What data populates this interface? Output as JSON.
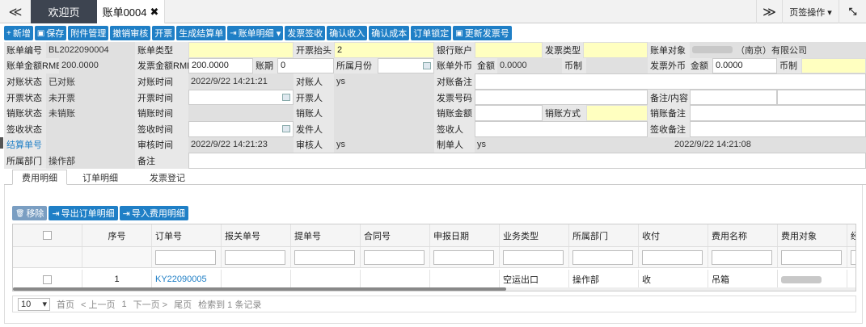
{
  "topbar": {
    "nav_left": "≪",
    "tab_welcome": "欢迎页",
    "tab_bill": "账单0004",
    "tab_close": "✖",
    "nav_right": "≫",
    "page_ops": "页签操作 ▾",
    "expand": "⤡"
  },
  "toolbar": [
    {
      "icon": "plus-icon",
      "glyph": "+",
      "label": "新增"
    },
    {
      "icon": "save-icon",
      "glyph": "▣",
      "label": "保存"
    },
    {
      "icon": "",
      "glyph": "",
      "label": "附件管理"
    },
    {
      "icon": "",
      "glyph": "",
      "label": "撤销审核"
    },
    {
      "icon": "",
      "glyph": "",
      "label": "开票"
    },
    {
      "icon": "",
      "glyph": "",
      "label": "生成结算单"
    },
    {
      "icon": "export-icon",
      "glyph": "⇥",
      "label": "账单明细 ▾"
    },
    {
      "icon": "",
      "glyph": "",
      "label": "发票签收"
    },
    {
      "icon": "",
      "glyph": "",
      "label": "确认收入"
    },
    {
      "icon": "",
      "glyph": "",
      "label": "确认成本"
    },
    {
      "icon": "",
      "glyph": "",
      "label": "订单锁定"
    },
    {
      "icon": "save-icon",
      "glyph": "▣",
      "label": "更新发票号"
    }
  ],
  "form": {
    "bill_no_label": "账单编号",
    "bill_no": "BL2022090004",
    "bill_type_label": "账单类型",
    "bill_type": "",
    "invoice_header_label": "开票抬头",
    "invoice_header": "2",
    "bank_account_label": "银行账户",
    "bank_account": "",
    "invoice_type_label": "发票类型",
    "invoice_type": "",
    "bill_target_label": "账单对象",
    "bill_target": "（南京）有限公司",
    "amount_rmb_label": "账单金额RMB",
    "amount_rmb": "200.0000",
    "invoice_amount_label": "发票金额RMB",
    "invoice_amount": "200.0000",
    "period_label": "账期",
    "period": "0",
    "month_label": "所属月份",
    "month": "",
    "foreign_label": "账单外币",
    "foreign_amount_label": "金额",
    "foreign_amount": "0.0000",
    "currency_label": "币制",
    "currency": "",
    "inv_foreign_label": "发票外币",
    "inv_foreign_amount_label": "金额",
    "inv_foreign_amount": "0.0000",
    "inv_currency_label": "币制",
    "inv_currency": "",
    "recon_status_label": "对账状态",
    "recon_status": "已对账",
    "recon_time_label": "对账时间",
    "recon_time": "2022/9/22 14:21:21",
    "recon_person_label": "对账人",
    "recon_person": "ys",
    "recon_note_label": "对账备注",
    "recon_note": "",
    "invoice_status_label": "开票状态",
    "invoice_status": "未开票",
    "invoice_time_label": "开票时间",
    "invoice_time": "",
    "invoicer_label": "开票人",
    "invoicer": "",
    "invoice_no_label": "发票号码",
    "invoice_no": "",
    "remark_content_label": "备注/内容",
    "remark_content": "",
    "writeoff_status_label": "销账状态",
    "writeoff_status": "未销账",
    "writeoff_time_label": "销账时间",
    "writeoff_time": "",
    "writeoff_person_label": "销账人",
    "writeoff_person": "",
    "writeoff_amount_label": "销账金额",
    "writeoff_amount": "",
    "writeoff_method_label": "销账方式",
    "writeoff_method": "",
    "writeoff_note_label": "销账备注",
    "writeoff_note": "",
    "sign_status_label": "签收状态",
    "sign_status": "",
    "sign_time_label": "签收时间",
    "sign_time": "",
    "sender_label": "发件人",
    "sender": "",
    "receiver_label": "签收人",
    "receiver": "",
    "sign_note_label": "签收备注",
    "sign_note": "",
    "settle_no_label": "结算单号",
    "settle_no": "",
    "audit_time_label": "审核时间",
    "audit_time": "2022/9/22 14:21:23",
    "auditor_label": "审核人",
    "auditor": "ys",
    "maker_label": "制单人",
    "maker": "ys",
    "make_time": "2022/9/22 14:21:08",
    "dept_label": "所属部门",
    "dept": "操作部",
    "remark_label": "备注",
    "remark": ""
  },
  "subtabs": [
    "费用明细",
    "订单明细",
    "发票登记"
  ],
  "grid_buttons": [
    {
      "icon": "trash-icon",
      "glyph": "🗑",
      "label": "移除"
    },
    {
      "icon": "export-icon",
      "glyph": "⇥",
      "label": "导出订单明细"
    },
    {
      "icon": "import-icon",
      "glyph": "⇥",
      "label": "导入费用明细"
    }
  ],
  "grid": {
    "headers": [
      "",
      "序号",
      "订单号",
      "报关单号",
      "提单号",
      "合同号",
      "申报日期",
      "业务类型",
      "所属部门",
      "收付",
      "费用名称",
      "费用对象",
      "经营"
    ],
    "rows": [
      [
        "",
        "1",
        "KY22090005",
        "",
        "",
        "",
        "",
        "空运出口",
        "操作部",
        "收",
        "吊箱",
        "",
        ""
      ]
    ]
  },
  "pager": {
    "page_size": "10",
    "first": "首页",
    "prev": "< 上一页",
    "page": "1",
    "next": "下一页 >",
    "last": "尾页",
    "summary": "检索到 1 条记录"
  }
}
